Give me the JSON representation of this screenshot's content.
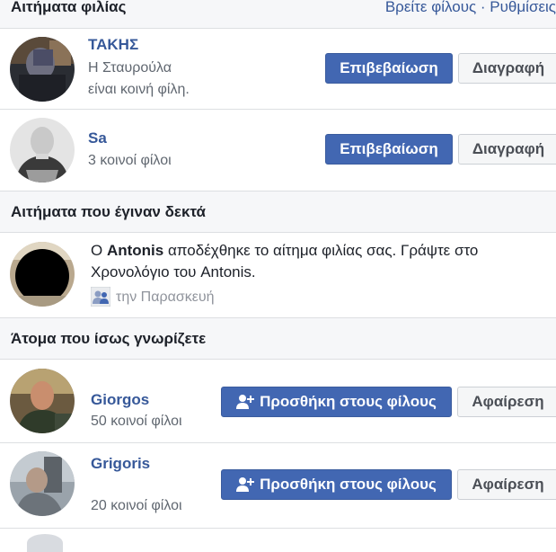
{
  "friend_requests": {
    "title": "Αιτήματα φιλίας",
    "link_find": "Βρείτε φίλους",
    "link_sep": " · ",
    "link_settings": "Ρυθμίσεις",
    "items": [
      {
        "name": "ΤΑΚΗΣ",
        "detail_line1": "Η Σταυρούλα",
        "detail_line2": "είναι κοινή φίλη.",
        "confirm": "Επιβεβαίωση",
        "delete": "Διαγραφή"
      },
      {
        "name": "Sa",
        "detail_line1": "3 κοινοί φίλοι",
        "confirm": "Επιβεβαίωση",
        "delete": "Διαγραφή"
      }
    ]
  },
  "accepted_requests": {
    "title": "Αιτήματα που έγιναν δεκτά",
    "item": {
      "prefix": "Ο ",
      "name": "Antonis",
      "message": " αποδέχθηκε το αίτημα φιλίας σας. Γράψτε στο Χρονολόγιο του Antonis.",
      "time": "την Παρασκευή",
      "icon": "friends-icon"
    }
  },
  "people_you_may_know": {
    "title": "Άτομα που ίσως γνωρίζετε",
    "items": [
      {
        "name": "Giorgos",
        "mutual": "50 κοινοί φίλοι",
        "add": "Προσθήκη στους φίλους",
        "remove": "Αφαίρεση"
      },
      {
        "name": "Grigoris",
        "mutual": "20 κοινοί φίλοι",
        "add": "Προσθήκη στους φίλους",
        "remove": "Αφαίρεση"
      }
    ]
  },
  "colors": {
    "brand": "#4267b2",
    "link": "#365899",
    "muted": "#606770",
    "header_bg": "#f6f7f9"
  }
}
